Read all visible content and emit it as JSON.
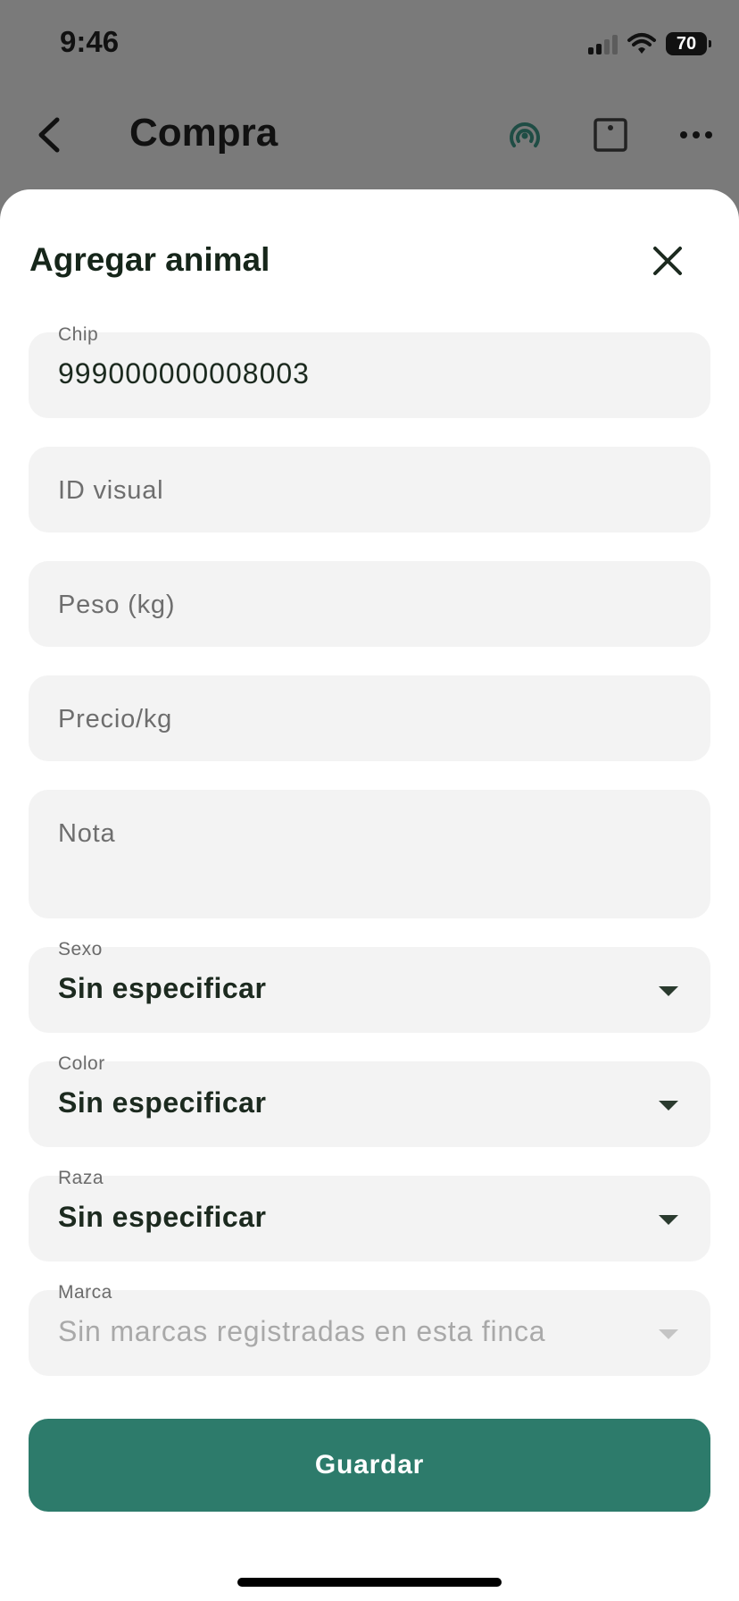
{
  "status_bar": {
    "time": "9:46",
    "battery": "70"
  },
  "app_bar": {
    "title": "Compra"
  },
  "sheet": {
    "title": "Agregar animal",
    "fields": {
      "chip": {
        "label": "Chip",
        "value": "999000000008003"
      },
      "visual_id": {
        "placeholder": "ID visual"
      },
      "weight": {
        "placeholder": "Peso (kg)"
      },
      "price": {
        "placeholder": "Precio/kg"
      },
      "note": {
        "placeholder": "Nota"
      },
      "sex": {
        "label": "Sexo",
        "value": "Sin especificar"
      },
      "color": {
        "label": "Color",
        "value": "Sin especificar"
      },
      "breed": {
        "label": "Raza",
        "value": "Sin especificar"
      },
      "brand": {
        "label": "Marca",
        "value": "Sin marcas registradas en esta finca",
        "disabled": true
      }
    },
    "save_label": "Guardar"
  },
  "colors": {
    "accent": "#2d7b6b",
    "field_bg": "#f3f3f3",
    "scrim": "#7a7a7a"
  }
}
